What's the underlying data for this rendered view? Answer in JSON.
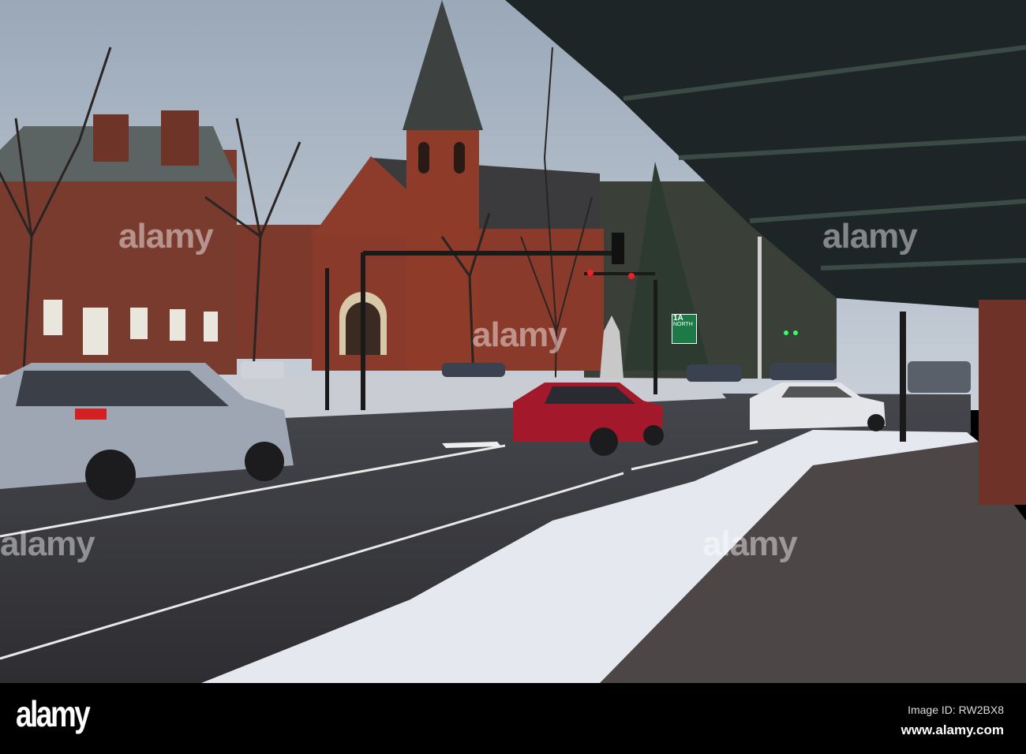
{
  "photo": {
    "watermarks": [
      "alamy",
      "alamy",
      "alamy",
      "alamy",
      "alamy"
    ],
    "road_sign": {
      "route": "1A",
      "direction": "NORTH"
    }
  },
  "footer": {
    "logo": "alamy",
    "image_id": "Image ID: RW2BX8",
    "website": "www.alamy.com"
  }
}
